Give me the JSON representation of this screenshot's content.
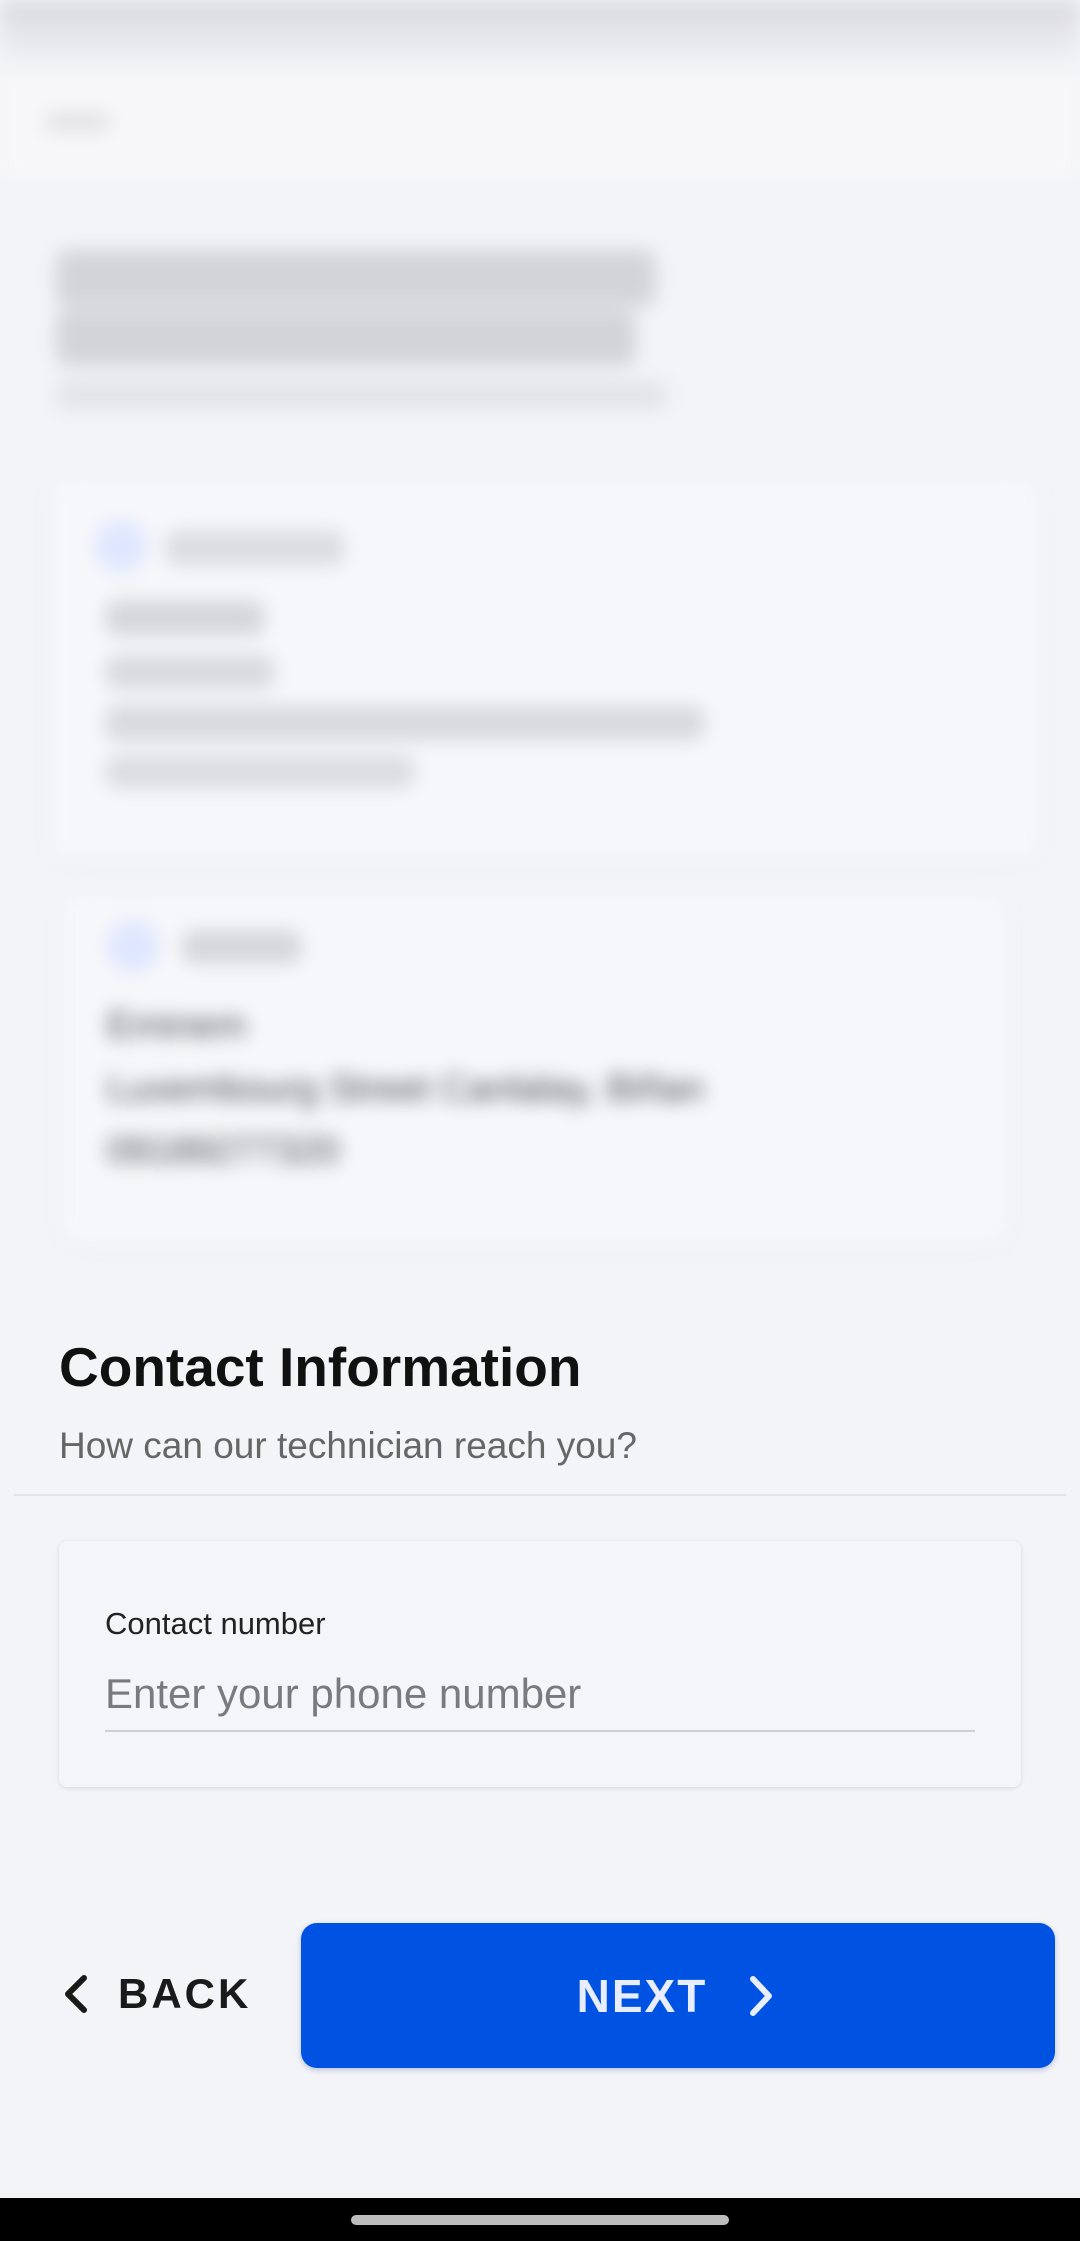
{
  "background_blurred": {
    "card2_line1": "Eminem",
    "card2_line2": "Luxembourg Street Canlalay, Biñan",
    "card2_line3": "09189277320"
  },
  "contact": {
    "title": "Contact Information",
    "subtitle": "How can our technician reach you?",
    "field_label": "Contact number",
    "field_placeholder": "Enter your phone number",
    "field_value": ""
  },
  "actions": {
    "back_label": "BACK",
    "next_label": "NEXT"
  },
  "colors": {
    "primary": "#0052e2",
    "background": "#f3f4f8"
  },
  "icons": {
    "back": "chevron-left-icon",
    "next": "chevron-right-icon"
  }
}
